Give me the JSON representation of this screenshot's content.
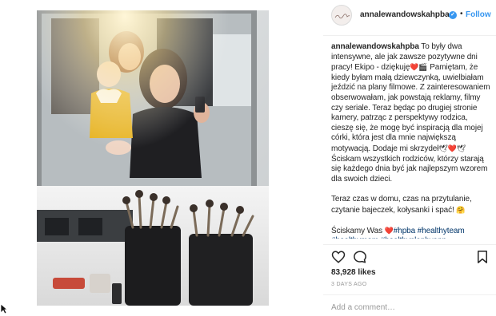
{
  "post": {
    "username": "annalewandowskahpba",
    "separator": "•",
    "follow_label": "Follow",
    "verified_mark": "✓",
    "avatar_icon": "avatar-signature-logo"
  },
  "caption": {
    "user": "annalewandowskahpba",
    "p1_text": "To były dwa intensywne, ale jak zawsze pozytywne dni pracy! Ekipo - dziękuję",
    "p1_emoji": "❤️🎬",
    "p1_rest": "Pamiętam, że kiedy byłam małą dziewczynką, uwielbiałam jeździć na plany filmowe. Z zainteresowaniem obserwowałam, jak powstają reklamy, filmy czy seriale. Teraz będąc po drugiej stronie kamery, patrząc z perspektywy rodzica, cieszę się, że mogę być inspiracją dla mojej córki, która jest dla mnie największą motywacją. Dodaje mi skrzydeł",
    "p1_emoji2": "🕊❤️🕊",
    "p1_end": "Ściskam wszystkich rodziców, którzy starają się każdego dnia być jak najlepszym wzorem dla swoich dzieci.",
    "p2_text": "Teraz czas w domu, czas na przytulanie, czytanie bajeczek, kołysanki i spać!",
    "p2_emoji": "🤗",
    "p3_text": "Ściskamy Was",
    "p3_emoji": "❤️",
    "tags": "#hpba #healthyteam #healthymom #healthyplanbyann"
  },
  "actions": {
    "like_icon": "heart-outline-icon",
    "comment_icon": "comment-bubble-icon",
    "save_icon": "bookmark-icon"
  },
  "likes": "83,928 likes",
  "timestamp": "3 DAYS AGO",
  "comment_box": {
    "placeholder": "Add a comment…"
  },
  "colors": {
    "link_blue": "#3897f0",
    "hashtag": "#003569",
    "text": "#262626",
    "muted": "#999999",
    "heart_red": "#e0245e"
  }
}
